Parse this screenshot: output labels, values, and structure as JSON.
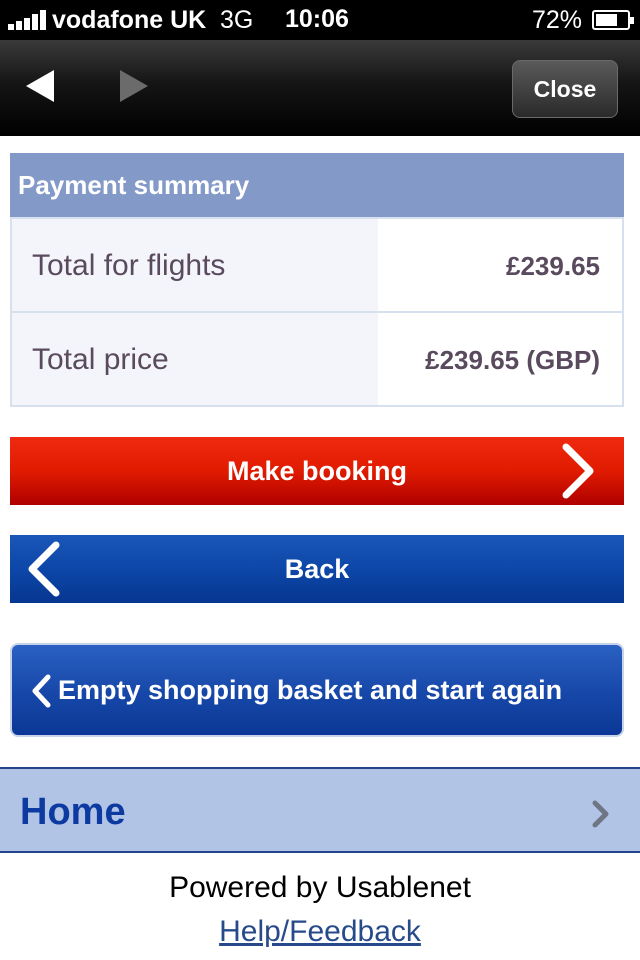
{
  "status_bar": {
    "carrier": "vodafone UK",
    "network": "3G",
    "time": "10:06",
    "battery_percent": "72%",
    "battery_level": 0.72
  },
  "browser": {
    "back_icon": "back-arrow-icon",
    "forward_icon": "forward-arrow-icon",
    "close_label": "Close"
  },
  "payment_summary": {
    "title": "Payment summary",
    "rows": [
      {
        "label": "Total for flights",
        "value": "£239.65"
      },
      {
        "label": "Total price",
        "value": "£239.65 (GBP)"
      }
    ]
  },
  "buttons": {
    "make_booking": "Make booking",
    "back": "Back",
    "empty_basket": "Empty shopping basket and start again"
  },
  "home": {
    "label": "Home"
  },
  "footer": {
    "powered_by": "Powered by Usablenet",
    "help_link": "Help/Feedback"
  },
  "colors": {
    "header_bg": "#8399c8",
    "make_booking_red": "#e01b00",
    "back_blue": "#0d47a8",
    "home_bg": "#b1c4e6",
    "home_text": "#0d3aa0"
  }
}
